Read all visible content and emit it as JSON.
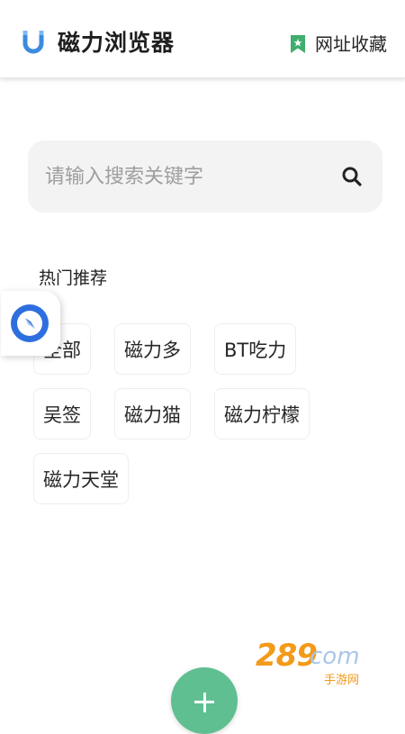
{
  "header": {
    "app_title": "磁力浏览器",
    "bookmarks_label": "网址收藏"
  },
  "search": {
    "placeholder": "请输入搜索关键字"
  },
  "hot": {
    "title": "热门推荐",
    "tags": [
      "全部",
      "磁力多",
      "BT吃力",
      "吴签",
      "磁力猫",
      "磁力柠檬",
      "磁力天堂"
    ]
  },
  "colors": {
    "accent_green": "#5fbf91",
    "logo_blue": "#3b8be0",
    "compass_blue": "#2e6fe0",
    "search_bg": "#f3f3f3"
  },
  "icons": {
    "logo": "magnet-icon",
    "bookmark": "bookmark-star-icon",
    "search": "search-icon",
    "compass": "compass-icon",
    "add": "plus-icon"
  },
  "watermark": {
    "number": "289",
    "com": "com",
    "sub": "手游网"
  }
}
